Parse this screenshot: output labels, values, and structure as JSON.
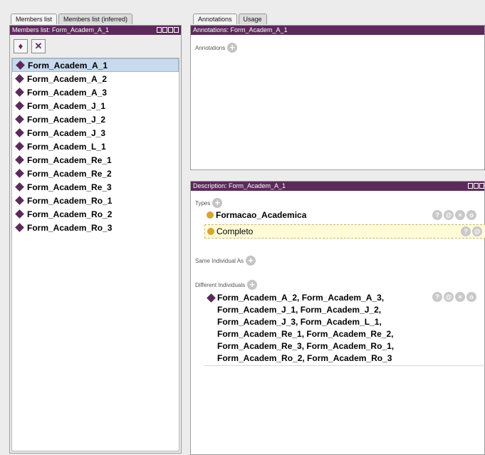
{
  "left_tabs": [
    "Members list",
    "Members list (inferred)"
  ],
  "right_tabs": [
    "Annotations",
    "Usage"
  ],
  "members": {
    "title": "Members list: Form_Academ_A_1",
    "toolbar_icons": [
      "add-individual-icon",
      "delete-individual-icon"
    ],
    "items": [
      "Form_Academ_A_1",
      "Form_Academ_A_2",
      "Form_Academ_A_3",
      "Form_Academ_J_1",
      "Form_Academ_J_2",
      "Form_Academ_J_3",
      "Form_Academ_L_1",
      "Form_Academ_Re_1",
      "Form_Academ_Re_2",
      "Form_Academ_Re_3",
      "Form_Academ_Ro_1",
      "Form_Academ_Ro_2",
      "Form_Academ_Ro_3"
    ],
    "selected": "Form_Academ_A_1"
  },
  "annotations": {
    "title": "Annotations: Form_Academ_A_1",
    "label": "Annotations"
  },
  "description": {
    "title": "Description: Form_Academ_A_1",
    "types_label": "Types",
    "types": [
      "Formacao_Academica",
      "Completo"
    ],
    "same_label": "Same Individual As",
    "different_label": "Different Individuals",
    "different_text": "Form_Academ_A_2, Form_Academ_A_3,\nForm_Academ_J_1, Form_Academ_J_2,\nForm_Academ_J_3, Form_Academ_L_1,\nForm_Academ_Re_1, Form_Academ_Re_2,\nForm_Academ_Re_3, Form_Academ_Ro_1,\nForm_Academ_Ro_2, Form_Academ_Ro_3"
  },
  "colors": {
    "titlebar": "#5c2a5a",
    "selection": "#c8dbee",
    "class_dot": "#d9a42c",
    "highlight": "#fffbd6"
  }
}
